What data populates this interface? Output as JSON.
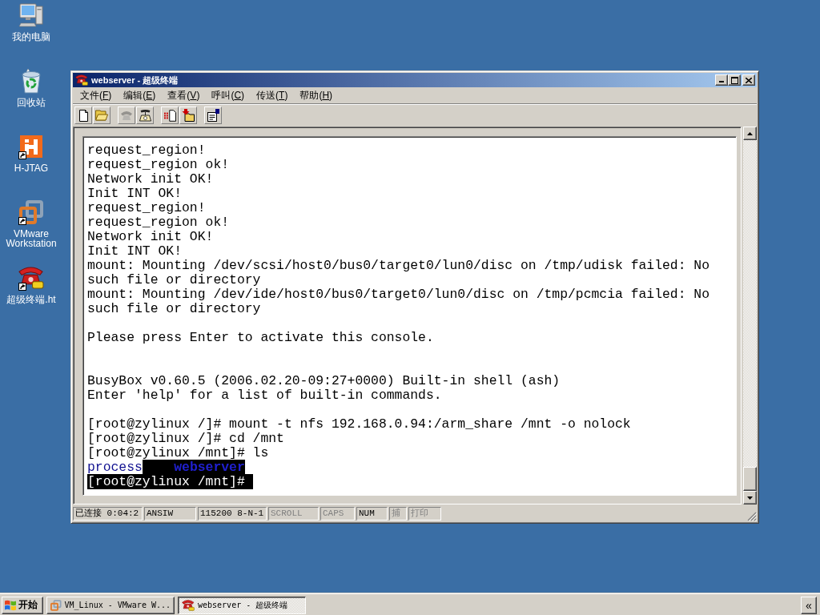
{
  "desktop_icons": [
    {
      "label": "我的电脑",
      "kind": "computer",
      "shortcut": false
    },
    {
      "label": "回收站",
      "kind": "recycle-bin",
      "shortcut": false
    },
    {
      "label": "H-JTAG",
      "kind": "hjtag",
      "shortcut": true
    },
    {
      "label": "VMware Workstation",
      "kind": "vmware",
      "shortcut": true
    },
    {
      "label": "超级终端.ht",
      "kind": "phone",
      "shortcut": true
    }
  ],
  "window": {
    "title": "webserver - 超级终端",
    "menu": [
      "文件(F)",
      "编辑(E)",
      "查看(V)",
      "呼叫(C)",
      "传送(T)",
      "帮助(H)"
    ],
    "toolbar": [
      [
        {
          "kind": "new",
          "disabled": false
        },
        {
          "kind": "open",
          "disabled": false
        }
      ],
      [
        {
          "kind": "call",
          "disabled": true
        },
        {
          "kind": "disconnect",
          "disabled": false
        }
      ],
      [
        {
          "kind": "send",
          "disabled": false
        },
        {
          "kind": "receive",
          "disabled": false
        }
      ],
      [
        {
          "kind": "properties",
          "disabled": false
        }
      ]
    ],
    "terminal": {
      "blocks": [
        [
          "request_region!",
          "request_region ok!",
          "Network init OK!",
          "Init INT OK!",
          "request_region!",
          "request_region ok!",
          "Network init OK!",
          "Init INT OK!",
          "mount: Mounting /dev/scsi/host0/bus0/target0/lun0/disc on /tmp/udisk failed: No",
          "such file or directory",
          "mount: Mounting /dev/ide/host0/bus0/target0/lun0/disc on /tmp/pcmcia failed: No",
          "such file or directory"
        ],
        [
          "Please press Enter to activate this console."
        ],
        [
          "BusyBox v0.60.5 (2006.02.20-09:27+0000) Built-in shell (ash)",
          "Enter 'help' for a list of built-in commands."
        ],
        [
          "[root@zylinux /]# mount -t nfs 192.168.0.94:/arm_share /mnt -o nolock",
          "[root@zylinux /]# cd /mnt",
          "[root@zylinux /mnt]# ls"
        ]
      ],
      "listing": [
        {
          "text": "process",
          "color": "#101090",
          "highlight": false
        },
        {
          "text": "webserver",
          "color": "#2020d0",
          "highlight": true
        }
      ],
      "prompt": {
        "text": "[root@zylinux /mnt]#",
        "highlight": true
      }
    },
    "status_bar": [
      {
        "text": "已连接 0:04:2",
        "disabled": false
      },
      {
        "text": "ANSIW",
        "disabled": false
      },
      {
        "text": "115200 8-N-1",
        "disabled": false
      },
      {
        "text": "SCROLL",
        "disabled": true
      },
      {
        "text": "CAPS",
        "disabled": true
      },
      {
        "text": "NUM",
        "disabled": false
      },
      {
        "text": "捕",
        "disabled": true
      },
      {
        "text": "打印",
        "disabled": true
      }
    ]
  },
  "taskbar": {
    "start": "开始",
    "tasks": [
      {
        "label": "VM_Linux - VMware W...",
        "kind": "vmware",
        "selected": false
      },
      {
        "label": "webserver - 超级终端",
        "kind": "phone",
        "selected": true
      }
    ],
    "tray_button": "«"
  }
}
